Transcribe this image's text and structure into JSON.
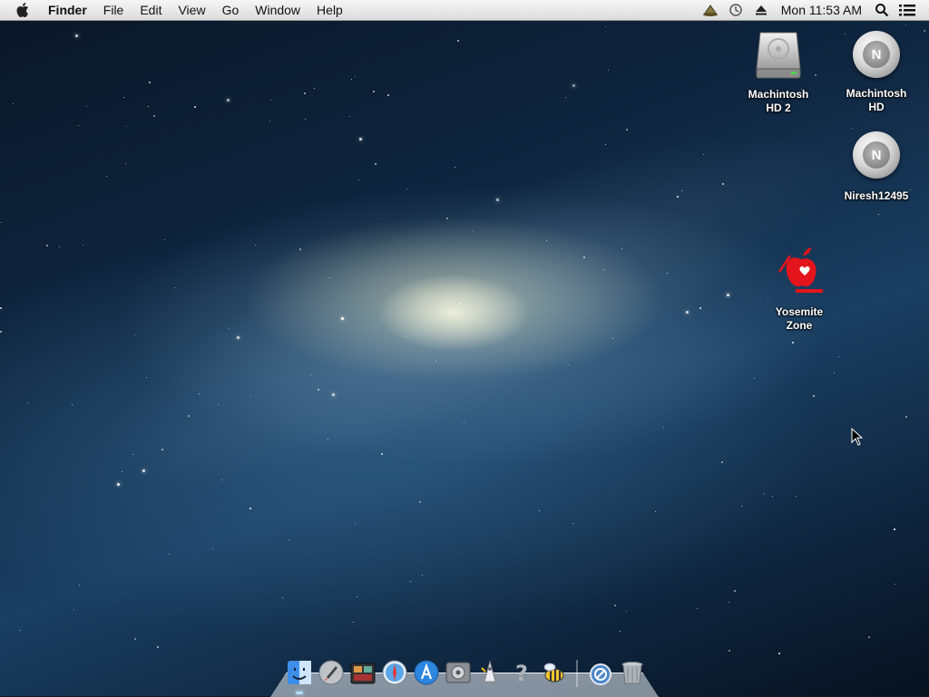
{
  "menubar": {
    "apple": "apple-menu",
    "items": [
      "Finder",
      "File",
      "Edit",
      "View",
      "Go",
      "Window",
      "Help"
    ],
    "clock": "Mon 11:53 AM",
    "status_icons": [
      "alfred-hat-icon",
      "time-machine-icon",
      "eject-icon",
      "spotlight-search-icon",
      "notification-center-icon"
    ]
  },
  "desktop": {
    "icons": [
      {
        "label": "Machintosh HD 2",
        "type": "hard-drive"
      },
      {
        "label": "Machintosh HD",
        "type": "disc"
      },
      {
        "label": "Niresh12495",
        "type": "disc"
      },
      {
        "label": "Yosemite Zone",
        "type": "app"
      }
    ]
  },
  "dock": {
    "items": [
      "finder",
      "launchpad",
      "photo-booth",
      "safari",
      "app-store",
      "system-preferences",
      "wizard-app",
      "help",
      "bee-app",
      "separator",
      "downloads",
      "trash"
    ]
  },
  "colors": {
    "menubar_top": "#f6f6f6",
    "menubar_bottom": "#dcdcdc",
    "desktop_label": "#ffffff",
    "yosemite_red": "#e4141c"
  }
}
